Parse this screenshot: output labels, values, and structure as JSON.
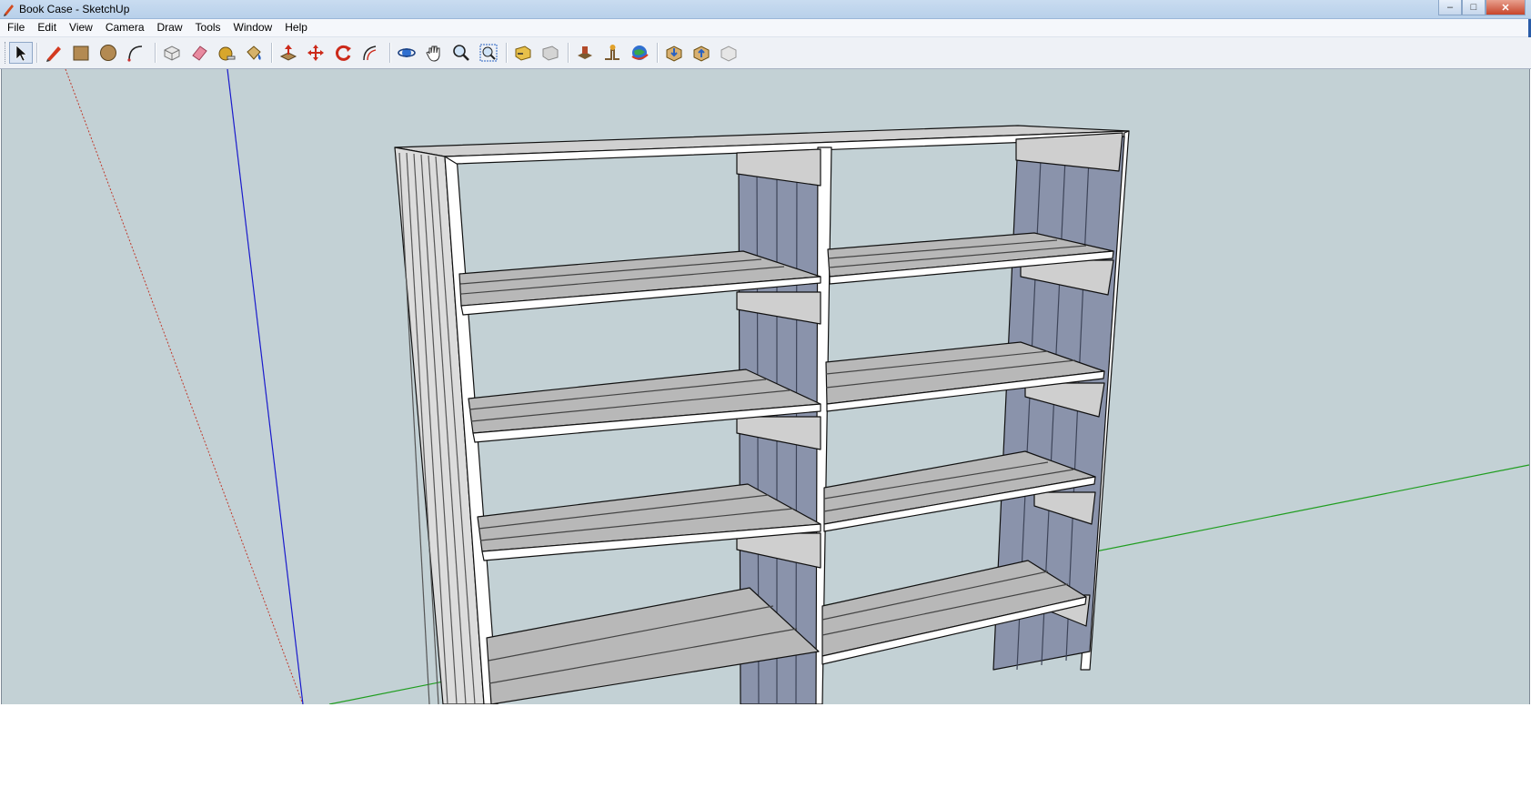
{
  "window": {
    "title": "Book Case - SketchUp",
    "buttons": {
      "minimize": "–",
      "maximize": "□",
      "close": "✕"
    }
  },
  "menu": [
    "File",
    "Edit",
    "View",
    "Camera",
    "Draw",
    "Tools",
    "Window",
    "Help"
  ],
  "toolbar": {
    "tools": [
      {
        "name": "select-tool",
        "icon": "arrow-icon"
      },
      {
        "name": "line-tool",
        "icon": "pencil-icon"
      },
      {
        "name": "rectangle-tool",
        "icon": "rectangle-icon"
      },
      {
        "name": "circle-tool",
        "icon": "circle-icon"
      },
      {
        "name": "arc-tool",
        "icon": "arc-icon"
      },
      {
        "name": "make-component-tool",
        "icon": "component-icon"
      },
      {
        "name": "eraser-tool",
        "icon": "eraser-icon"
      },
      {
        "name": "tape-measure-tool",
        "icon": "tape-measure-icon"
      },
      {
        "name": "paint-bucket-tool",
        "icon": "paint-bucket-icon"
      },
      {
        "name": "push-pull-tool",
        "icon": "push-pull-icon"
      },
      {
        "name": "move-tool",
        "icon": "move-icon"
      },
      {
        "name": "rotate-tool",
        "icon": "rotate-icon"
      },
      {
        "name": "offset-tool",
        "icon": "offset-icon"
      },
      {
        "name": "orbit-tool",
        "icon": "orbit-icon"
      },
      {
        "name": "pan-tool",
        "icon": "hand-icon"
      },
      {
        "name": "zoom-tool",
        "icon": "magnifier-icon"
      },
      {
        "name": "zoom-extents-tool",
        "icon": "zoom-extents-icon"
      },
      {
        "name": "previous-view-tool",
        "icon": "previous-view-icon"
      },
      {
        "name": "next-view-tool",
        "icon": "next-view-icon"
      },
      {
        "name": "add-location-tool",
        "icon": "add-location-icon"
      },
      {
        "name": "toggle-terrain-tool",
        "icon": "toggle-terrain-icon"
      },
      {
        "name": "photo-textures-tool",
        "icon": "globe-icon"
      },
      {
        "name": "get-models-tool",
        "icon": "get-models-icon"
      },
      {
        "name": "share-model-tool",
        "icon": "share-model-icon"
      },
      {
        "name": "share-component-tool",
        "icon": "share-component-icon"
      }
    ]
  },
  "colors": {
    "viewport_background": "#c3d1d5",
    "axis_red": "#c0392b",
    "axis_green": "#1f9d1f",
    "axis_blue": "#1a1acc",
    "shelf_top": "#b8b8b8",
    "panel_face": "#ffffff",
    "back_slats": "#8a93ab"
  }
}
